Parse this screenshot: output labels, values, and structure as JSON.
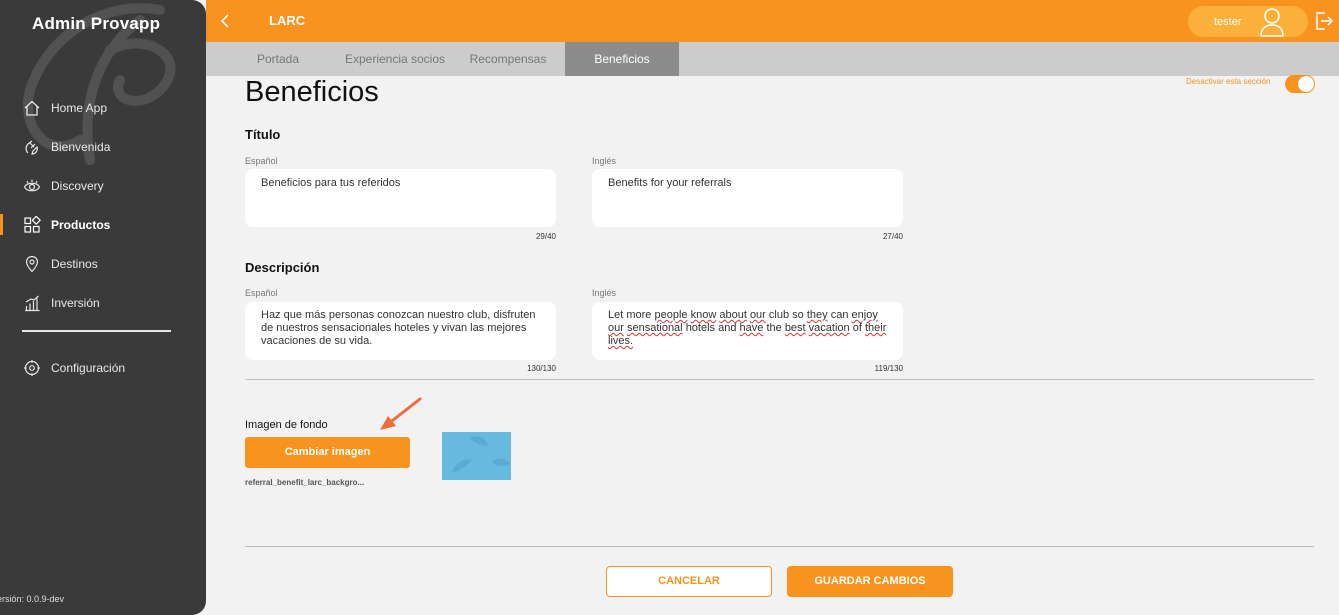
{
  "sidebar": {
    "brand": "Admin Provapp",
    "items": [
      {
        "label": "Home App",
        "icon": "home-icon"
      },
      {
        "label": "Bienvenida",
        "icon": "wave-hand-icon"
      },
      {
        "label": "Discovery",
        "icon": "eye-icon"
      },
      {
        "label": "Productos",
        "icon": "grid-icon",
        "active": true
      },
      {
        "label": "Destinos",
        "icon": "map-pin-icon"
      },
      {
        "label": "Inversión",
        "icon": "bar-chart-icon"
      }
    ],
    "config": {
      "label": "Configuración",
      "icon": "gear-icon"
    },
    "version": "ersión: 0.0.9-dev"
  },
  "topbar": {
    "title": "LARC",
    "user_name": "tester"
  },
  "tabs": [
    {
      "label": "Portada"
    },
    {
      "label": "Experiencia socios"
    },
    {
      "label": "Recompensas"
    },
    {
      "label": "Beneficios",
      "active": true
    }
  ],
  "main": {
    "page_title": "Beneficios",
    "toggle_label": "Desactivar esta sección",
    "toggle_on": true,
    "titulo": {
      "heading": "Título",
      "es_label": "Español",
      "es_value": "Beneficios para tus referidos",
      "es_counter": "29/40",
      "en_label": "Inglés",
      "en_value": "Benefits for your referrals",
      "en_counter": "27/40"
    },
    "descripcion": {
      "heading": "Descripción",
      "es_label": "Español",
      "es_value": "Haz que más personas conozcan nuestro club, disfruten de nuestros sensacionales hoteles y vivan las mejores vacaciones de su vida.",
      "es_counter": "130/130",
      "en_label": "Inglés",
      "en_value": "Let more people know about our club so they can enjoy our sensational hotels and have the best vacation of their lives.",
      "en_counter": "119/130"
    },
    "imagen": {
      "label": "Imagen de fondo",
      "button": "Cambiar imagen",
      "filename": "referral_benefit_larc_backgro..."
    },
    "actions": {
      "cancel": "CANCELAR",
      "save": "GUARDAR CAMBIOS"
    }
  },
  "colors": {
    "accent": "#f7931e",
    "sidebar_bg": "#3a3a3a",
    "tabs_bg": "#cccccc",
    "tab_active_bg": "#8c8c8c",
    "page_bg": "#f2f2f2",
    "thumbnail": "#68b9e0"
  }
}
